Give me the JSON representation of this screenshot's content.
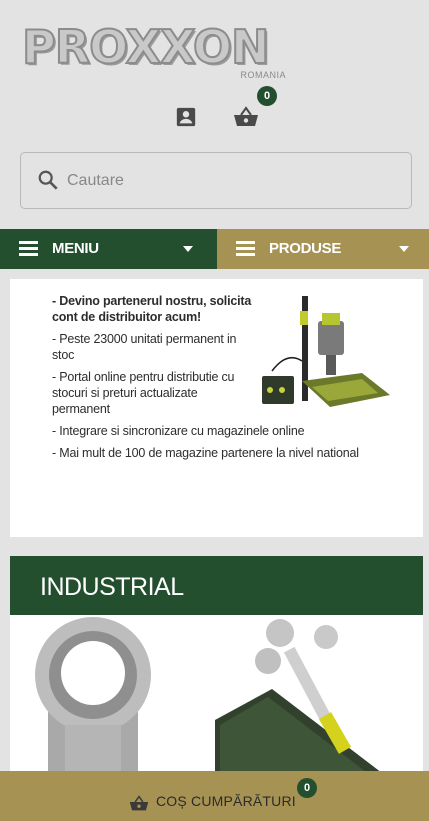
{
  "header": {
    "logo_text": "PROXXON",
    "logo_sub": "ROMANIA",
    "user_icon": "account-box-icon",
    "basket_icon": "basket-icon",
    "cart_count": "0"
  },
  "search": {
    "placeholder": "Cautare",
    "icon": "search-icon"
  },
  "nav": {
    "menu_label": "MENIU",
    "products_label": "PRODUSE"
  },
  "promo": {
    "title": "- Devino partenerul nostru, solicita cont de distribuitor acum!",
    "items": [
      "- Peste 23000 unitati permanent in stoc",
      "- Portal online pentru distributie cu stocuri si preturi actualizate permanent",
      "- Integrare si sincronizare cu magazinele online",
      "- Mai mult de 100 de magazine partenere la nivel national"
    ]
  },
  "industrial": {
    "title": "INDUSTRIAL"
  },
  "cart_bar": {
    "label": "COȘ CUMPĂRĂTURI",
    "count": "0"
  },
  "colors": {
    "green": "#234f2f",
    "gold": "#a69252",
    "background": "#e3e3e3"
  }
}
